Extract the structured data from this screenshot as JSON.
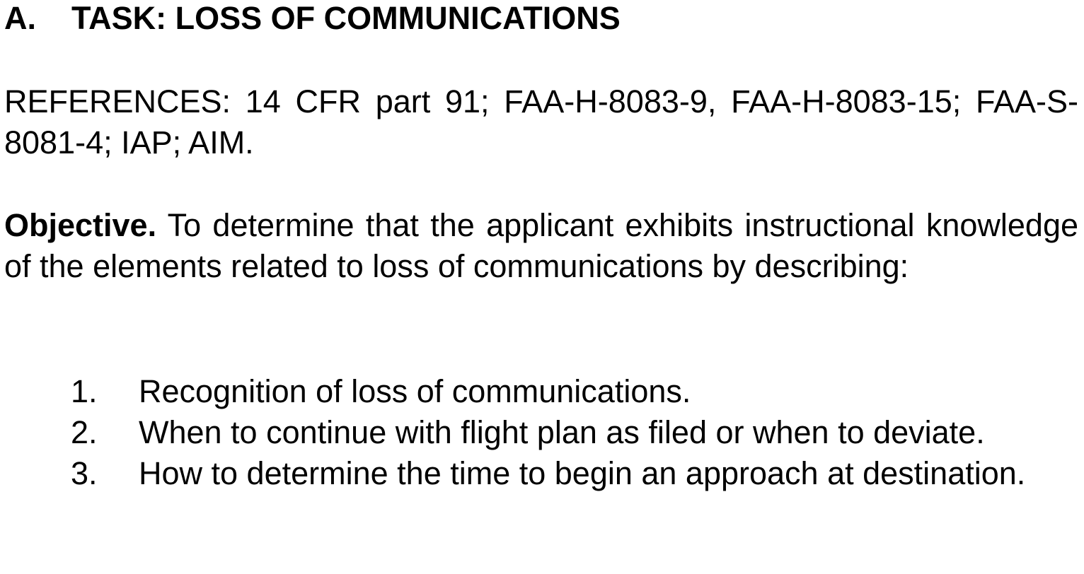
{
  "task": {
    "letter": "A.",
    "title": "TASK: LOSS OF COMMUNICATIONS"
  },
  "references": "REFERENCES: 14 CFR part 91; FAA-H-8083-9, FAA-H-8083-15; FAA-S-8081-4; IAP; AIM.",
  "objective": {
    "label": "Objective.",
    "text": " To determine that the applicant exhibits instructional knowledge of the elements related to loss of communications by describing:"
  },
  "elements": [
    {
      "number": "1.",
      "text": "Recognition of loss of communications."
    },
    {
      "number": "2.",
      "text": "When to continue with flight plan as filed or when to deviate."
    },
    {
      "number": "3.",
      "text": "How to determine the time to begin an approach at destination."
    }
  ]
}
